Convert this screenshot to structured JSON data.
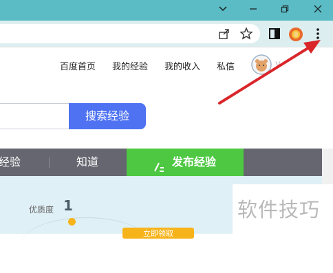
{
  "browser": {
    "window_controls": {
      "minimize": "⌄",
      "restore": "–",
      "maximize": "❐",
      "close": "✕"
    }
  },
  "nav": {
    "links": [
      "百度首页",
      "我的经验",
      "我的收入",
      "私信"
    ],
    "username_partial": "v"
  },
  "search": {
    "button_label": "搜索经验"
  },
  "categories": {
    "items": [
      "经验",
      "知道"
    ],
    "publish_label": "发布经验"
  },
  "panel": {
    "quality_label": "优质度",
    "quality_value": "1",
    "orange_button": "立即领取"
  },
  "watermark": {
    "text": "软件技巧"
  },
  "colors": {
    "titlebar": "#5bbcc6",
    "search_button": "#4e72f2",
    "publish": "#4ec843",
    "arrow": "#d9262b"
  }
}
